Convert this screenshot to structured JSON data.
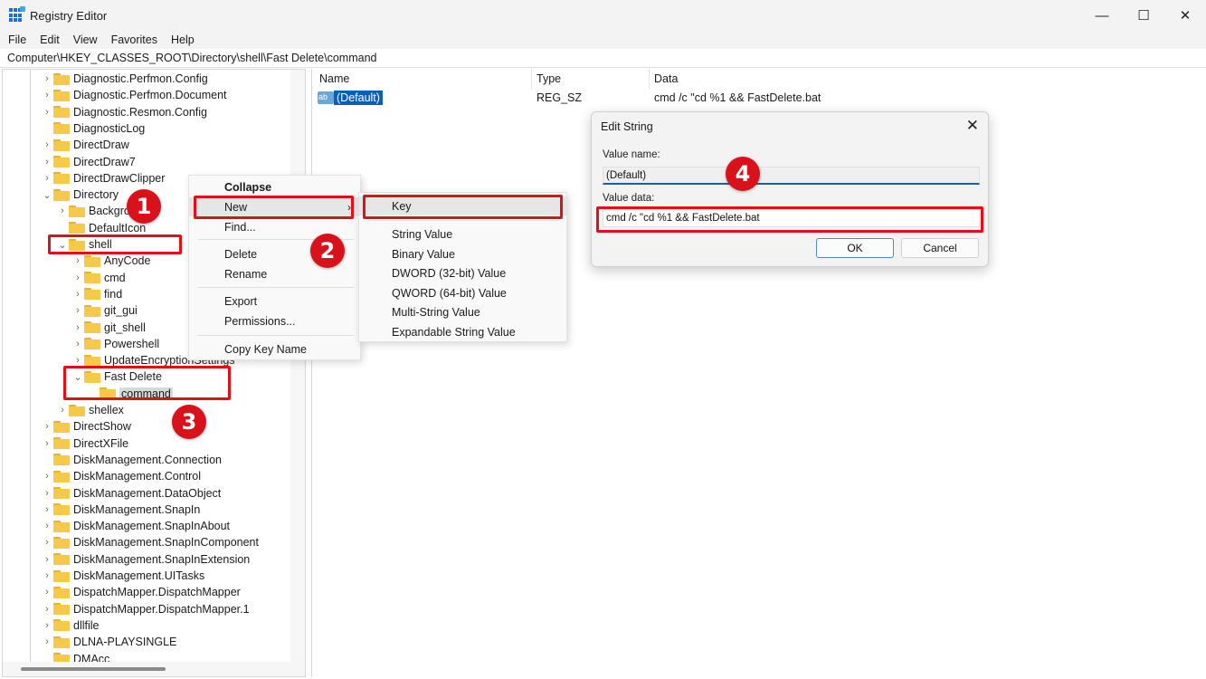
{
  "window": {
    "title": "Registry Editor",
    "controls": {
      "minimize": "—",
      "maximize": "☐",
      "close": "✕"
    }
  },
  "menu": [
    "File",
    "Edit",
    "View",
    "Favorites",
    "Help"
  ],
  "address": "Computer\\HKEY_CLASSES_ROOT\\Directory\\shell\\Fast Delete\\command",
  "tree": [
    {
      "label": "Diagnostic.Perfmon.Config",
      "level": 0,
      "chevron": ">"
    },
    {
      "label": "Diagnostic.Perfmon.Document",
      "level": 0,
      "chevron": ">"
    },
    {
      "label": "Diagnostic.Resmon.Config",
      "level": 0,
      "chevron": ">"
    },
    {
      "label": "DiagnosticLog",
      "level": 0,
      "chevron": ""
    },
    {
      "label": "DirectDraw",
      "level": 0,
      "chevron": ">"
    },
    {
      "label": "DirectDraw7",
      "level": 0,
      "chevron": ">"
    },
    {
      "label": "DirectDrawClipper",
      "level": 0,
      "chevron": ">"
    },
    {
      "label": "Directory",
      "level": 0,
      "chevron": "v"
    },
    {
      "label": "Background",
      "level": 1,
      "chevron": ">"
    },
    {
      "label": "DefaultIcon",
      "level": 1,
      "chevron": ""
    },
    {
      "label": "shell",
      "level": 1,
      "chevron": "v"
    },
    {
      "label": "AnyCode",
      "level": 2,
      "chevron": ">"
    },
    {
      "label": "cmd",
      "level": 2,
      "chevron": ">"
    },
    {
      "label": "find",
      "level": 2,
      "chevron": ">"
    },
    {
      "label": "git_gui",
      "level": 2,
      "chevron": ">"
    },
    {
      "label": "git_shell",
      "level": 2,
      "chevron": ">"
    },
    {
      "label": "Powershell",
      "level": 2,
      "chevron": ">"
    },
    {
      "label": "UpdateEncryptionSettings",
      "level": 2,
      "chevron": ">"
    },
    {
      "label": "Fast Delete",
      "level": 2,
      "chevron": "v"
    },
    {
      "label": "command",
      "level": 3,
      "chevron": "",
      "selected": true
    },
    {
      "label": "shellex",
      "level": 1,
      "chevron": ">"
    },
    {
      "label": "DirectShow",
      "level": 0,
      "chevron": ">"
    },
    {
      "label": "DirectXFile",
      "level": 0,
      "chevron": ">"
    },
    {
      "label": "DiskManagement.Connection",
      "level": 0,
      "chevron": ""
    },
    {
      "label": "DiskManagement.Control",
      "level": 0,
      "chevron": ">"
    },
    {
      "label": "DiskManagement.DataObject",
      "level": 0,
      "chevron": ">"
    },
    {
      "label": "DiskManagement.SnapIn",
      "level": 0,
      "chevron": ">"
    },
    {
      "label": "DiskManagement.SnapInAbout",
      "level": 0,
      "chevron": ">"
    },
    {
      "label": "DiskManagement.SnapInComponent",
      "level": 0,
      "chevron": ">"
    },
    {
      "label": "DiskManagement.SnapInExtension",
      "level": 0,
      "chevron": ">"
    },
    {
      "label": "DiskManagement.UITasks",
      "level": 0,
      "chevron": ">"
    },
    {
      "label": "DispatchMapper.DispatchMapper",
      "level": 0,
      "chevron": ">"
    },
    {
      "label": "DispatchMapper.DispatchMapper.1",
      "level": 0,
      "chevron": ">"
    },
    {
      "label": "dllfile",
      "level": 0,
      "chevron": ">"
    },
    {
      "label": "DLNA-PLAYSINGLE",
      "level": 0,
      "chevron": ">"
    },
    {
      "label": "DMAcc",
      "level": 0,
      "chevron": ""
    }
  ],
  "values": {
    "headers": {
      "name": "Name",
      "type": "Type",
      "data": "Data"
    },
    "rows": [
      {
        "icon": "ab",
        "name": "(Default)",
        "type": "REG_SZ",
        "data": "cmd /c \"cd %1 && FastDelete.bat"
      }
    ]
  },
  "context_menu": {
    "items": [
      {
        "label": "Collapse",
        "bold": true
      },
      {
        "label": "New",
        "submenu_arrow": "›",
        "hover": true
      },
      {
        "label": "Find..."
      },
      {
        "separator": true
      },
      {
        "label": "Delete"
      },
      {
        "label": "Rename"
      },
      {
        "separator": true
      },
      {
        "label": "Export"
      },
      {
        "label": "Permissions..."
      },
      {
        "separator": true
      },
      {
        "label": "Copy Key Name"
      }
    ]
  },
  "new_submenu": {
    "items": [
      {
        "label": "Key",
        "hover": true
      },
      {
        "separator": true
      },
      {
        "label": "String Value"
      },
      {
        "label": "Binary Value"
      },
      {
        "label": "DWORD (32-bit) Value"
      },
      {
        "label": "QWORD (64-bit) Value"
      },
      {
        "label": "Multi-String Value"
      },
      {
        "label": "Expandable String Value"
      }
    ]
  },
  "dialog": {
    "title": "Edit String",
    "close_icon": "✕",
    "value_name_label": "Value name:",
    "value_name": "(Default)",
    "value_data_label": "Value data:",
    "value_data": "cmd /c \"cd %1 && FastDelete.bat",
    "ok_label": "OK",
    "cancel_label": "Cancel"
  },
  "annotations": {
    "steps": [
      "1",
      "2",
      "3",
      "4"
    ],
    "highlight_color": "#e0101a"
  }
}
